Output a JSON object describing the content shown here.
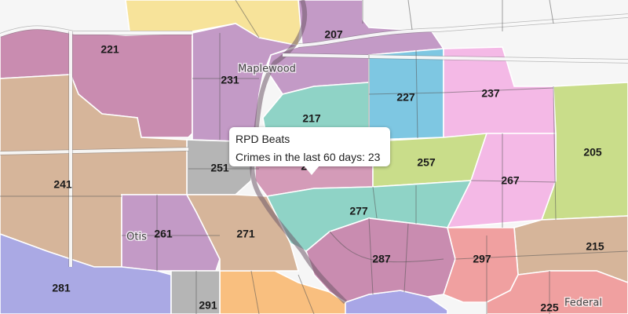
{
  "popup": {
    "title": "RPD Beats",
    "detail": "Crimes in the last 60 days: 23"
  },
  "places": {
    "maplewood": "Maplewood",
    "otis": "Otis",
    "federal": "Federal"
  },
  "beats": [
    {
      "id": "221",
      "color": "#c98cb0"
    },
    {
      "id": "207",
      "color": "#c39ac6"
    },
    {
      "id": "231",
      "color": "#c39ac6"
    },
    {
      "id": "227",
      "color": "#7ec7e2"
    },
    {
      "id": "237",
      "color": "#f4b9e6"
    },
    {
      "id": "217",
      "color": "#8fd3c6"
    },
    {
      "id": "205",
      "color": "#c9dd8a"
    },
    {
      "id": "251",
      "color": "#b5b5b5"
    },
    {
      "id": "247",
      "color": "#d49bb8"
    },
    {
      "id": "257",
      "color": "#c9dd8a"
    },
    {
      "id": "241",
      "color": "#d6b59a"
    },
    {
      "id": "267",
      "color": "#f4b9e6"
    },
    {
      "id": "277",
      "color": "#8fd3c6"
    },
    {
      "id": "261",
      "color": "#c39ac6"
    },
    {
      "id": "271",
      "color": "#d6b59a"
    },
    {
      "id": "215",
      "color": "#d6b59a"
    },
    {
      "id": "287",
      "color": "#c98cb0"
    },
    {
      "id": "297",
      "color": "#f0a0a0"
    },
    {
      "id": "281",
      "color": "#aaa9e4"
    },
    {
      "id": "291",
      "color": "#b5b5b5"
    },
    {
      "id": "225",
      "color": "#f0a0a0"
    }
  ],
  "extra_colors": {
    "yellow": "#f7e39a",
    "orange": "#f9bf7f",
    "blue": "#a8a6e6",
    "water": "#d8d8d8"
  }
}
